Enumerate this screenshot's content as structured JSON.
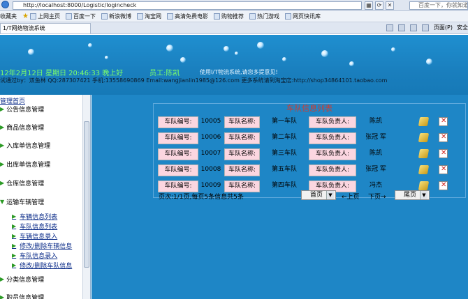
{
  "browser": {
    "url": "http://localhost:8000/Logistic/logincheck",
    "search_placeholder": "百度一下，你就知道",
    "tab_title": "1/T网络物流系统",
    "favorites": [
      {
        "label": "收藏夹"
      },
      {
        "label": "上网主页"
      },
      {
        "label": "百度一下"
      },
      {
        "label": "新浪微博"
      },
      {
        "label": "淘宝网"
      },
      {
        "label": "高清免费电影"
      },
      {
        "label": "购物推荐"
      },
      {
        "label": "热门游戏"
      },
      {
        "label": "网页快讯库"
      }
    ],
    "tools": {
      "page": "页面(P)",
      "safety": "安全"
    }
  },
  "header": {
    "datetime": "12年2月12日 星期日 20:46:33 晚上好",
    "staff": "员工:陈凯",
    "slogan": "使用I/T物流系统,请您多提意见!",
    "contact": "试通过by：双鱼林 QQ:287307421 手机:13558690869 Email:wangjianlin1985@126.com 更多系统请到淘宝店:http://shop34864101.taobao.com"
  },
  "sidebar": {
    "home": "管理首页",
    "menus": [
      {
        "label": "公告信息管理"
      },
      {
        "label": "商品信息管理"
      },
      {
        "label": "入库单信息管理"
      },
      {
        "label": "出库单信息管理"
      },
      {
        "label": "仓库信息管理"
      },
      {
        "label": "运输车辆管理"
      },
      {
        "label": "分类信息管理"
      },
      {
        "label": "职员信息管理"
      }
    ],
    "subitems": [
      {
        "label": "车辆信息列表"
      },
      {
        "label": "车队信息列表"
      },
      {
        "label": "车辆信息录入"
      },
      {
        "label": "修改/删除车辆信息"
      },
      {
        "label": "车队信息录入"
      },
      {
        "label": "修改/删除车队信息"
      }
    ]
  },
  "main": {
    "title": "车队信息列表",
    "label_id": "车队编号:",
    "label_name": "车队名称:",
    "label_leader": "车队负责人:",
    "rows": [
      {
        "id": "10005",
        "name": "第一车队",
        "leader": "陈凯"
      },
      {
        "id": "10006",
        "name": "第二车队",
        "leader": "张冠 军"
      },
      {
        "id": "10007",
        "name": "第三车队",
        "leader": "陈凯"
      },
      {
        "id": "10008",
        "name": "第五车队",
        "leader": "张冠 军"
      },
      {
        "id": "10009",
        "name": "第四车队",
        "leader": "冯杰"
      }
    ],
    "pager": {
      "info": "页次:1/1页,每页5条信息共5条",
      "first": "首页",
      "prev": "←上页",
      "next": "下页→",
      "last": "尾页"
    }
  }
}
